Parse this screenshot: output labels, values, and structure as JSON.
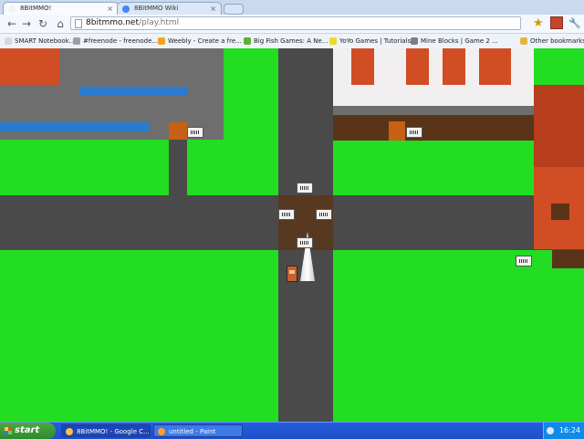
{
  "browser": {
    "tabs": [
      {
        "label": "8BitMMO!",
        "close": "×",
        "active": true,
        "icon_color": "#f3f3f3"
      },
      {
        "label": "8BitMMO Wiki",
        "close": "×",
        "active": false,
        "icon_color": "#3d8bf3"
      }
    ],
    "address": {
      "domain": "8bitmmo.net",
      "path": "/play.html"
    },
    "bookmarks": [
      {
        "label": "SMART Notebook...",
        "icon_color": "#d8d8d8"
      },
      {
        "label": "#freenode - freenode...",
        "icon_color": "#9f9f9f"
      },
      {
        "label": "Weebly - Create a fre...",
        "icon_color": "#f4a51f"
      },
      {
        "label": "Big Fish Games: A Ne...",
        "icon_color": "#5fb02f"
      },
      {
        "label": "YoYo Games | Tutorials",
        "icon_color": "#f0d92a"
      },
      {
        "label": "Mine Blocks | Game 2 ...",
        "icon_color": "#7f7f7f"
      },
      {
        "label": "Other bookmarks",
        "icon_color": "#e5b540"
      }
    ],
    "icons": {
      "back": "back-arrow-icon",
      "forward": "forward-arrow-icon",
      "reload": "reload-icon",
      "home": "home-icon",
      "star": "star-icon",
      "extension": "extension-icon",
      "wrench": "wrench-icon",
      "new_tab": "new-tab-icon"
    }
  },
  "game": {
    "scene": "8bit-mmo-world"
  },
  "taskbar": {
    "start_label": "start",
    "tasks": [
      {
        "label": "8BitMMO! - Google C...",
        "active": true,
        "icon_color": "#f4c24a"
      },
      {
        "label": "untitled - Paint",
        "active": false,
        "icon_color": "#ff9f30"
      }
    ],
    "time": "16:24"
  }
}
